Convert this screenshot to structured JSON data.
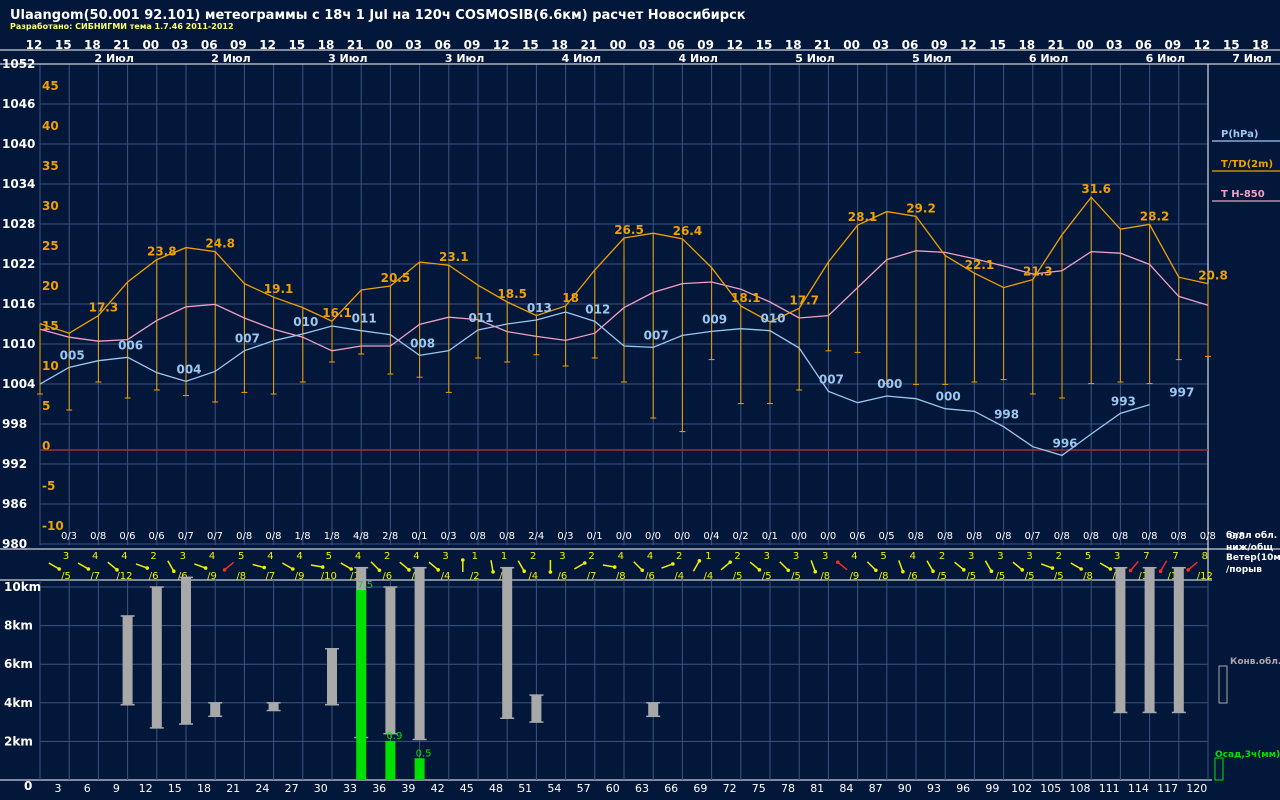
{
  "title": "Ulaangom(50.001 92.101) метеограммы с  18ч 1 Jul на 120ч COSMOSIB(6.6км) расчет Новосибирск",
  "subtitle": "Разработано: СИБНИГМИ тема 1.7.46 2011-2012",
  "colors": {
    "background": "#03173a",
    "grid": "#3a5580",
    "pressure": "#9cc8f0",
    "temperature": "#f0a000",
    "t850": "#f0a0c0",
    "zero": "#a03030",
    "cloud": "#a8a8a8",
    "precip": "#00e000",
    "wind": "#f0f000",
    "wind_strong": "#f03020",
    "text": "#ffffff"
  },
  "chart_data": [
    {
      "type": "line",
      "name": "meteogram",
      "hours_top": [
        "12",
        "15",
        "18",
        "21",
        "00",
        "03",
        "06",
        "09",
        "12",
        "15",
        "18",
        "21",
        "00",
        "03",
        "06",
        "09",
        "12",
        "15",
        "18",
        "21",
        "00",
        "03",
        "06",
        "09",
        "12",
        "15",
        "18",
        "21",
        "00",
        "03",
        "06",
        "09",
        "12",
        "15",
        "18",
        "21",
        "00",
        "03",
        "06",
        "09",
        "12",
        "15",
        "18",
        "21",
        "00",
        "03",
        "06",
        "09",
        "12",
        "15",
        "18",
        "21",
        "00",
        "03",
        "06",
        "09",
        "12"
      ],
      "day_labels": [
        {
          "col": 1,
          "text": "2 Июл"
        },
        {
          "col": 5,
          "text": "2 Июл"
        },
        {
          "col": 9,
          "text": "3 Июл"
        },
        {
          "col": 13,
          "text": "3 Июл"
        },
        {
          "col": 17,
          "text": "4 Июл"
        },
        {
          "col": 21,
          "text": "4 Июл"
        },
        {
          "col": 25,
          "text": "5 Июл"
        },
        {
          "col": 29,
          "text": "5 Июл"
        },
        {
          "col": 33,
          "text": "6 Июл"
        },
        {
          "col": 37,
          "text": "6 Июл"
        }
      ],
      "day_label_right": "7 Июл",
      "pressure_ticks": [
        "1052",
        "1046",
        "1040",
        "1034",
        "1028",
        "1022",
        "1016",
        "1010",
        "1004",
        "998",
        "992",
        "986",
        "980"
      ],
      "temp_ticks": [
        "45",
        "40",
        "35",
        "30",
        "25",
        "20",
        "15",
        "10",
        "5",
        "0",
        "-5",
        "-10"
      ],
      "legend": {
        "pressure": "P(hPa)",
        "temperature": "T/TD(2m)",
        "t850": "T H-850"
      },
      "pressure": [
        1004,
        1006.5,
        1007.5,
        1008,
        1005.7,
        1004.4,
        1005.9,
        1009,
        1010.5,
        1011.5,
        1012.7,
        1012,
        1011.4,
        1008.3,
        1009,
        1012.1,
        1013,
        1013.6,
        1014.8,
        1013.4,
        1009.7,
        1009.5,
        1011.3,
        1011.9,
        1012.3,
        1012,
        1009.4,
        1002.9,
        1001.2,
        1002.2,
        1001.8,
        1000.3,
        999.9,
        997.6,
        994.6,
        993.3,
        996.5,
        999.6,
        1000.9
      ],
      "pressure_labels": [
        [
          1,
          "005"
        ],
        [
          3,
          "006"
        ],
        [
          5,
          "004"
        ],
        [
          7,
          "007"
        ],
        [
          9,
          "010"
        ],
        [
          11,
          "011"
        ],
        [
          13,
          "008"
        ],
        [
          15,
          "011"
        ],
        [
          17,
          "013"
        ],
        [
          19,
          "012"
        ],
        [
          21,
          "007"
        ],
        [
          23,
          "009"
        ],
        [
          25,
          "010"
        ],
        [
          27,
          "007"
        ],
        [
          29,
          "000"
        ],
        [
          31,
          "000"
        ],
        [
          33,
          "998"
        ],
        [
          35,
          "996"
        ],
        [
          37,
          "993"
        ],
        [
          39,
          "997"
        ]
      ],
      "temp_max": [
        15.8,
        14.6,
        16.8,
        21,
        23.8,
        25.3,
        24.8,
        20.8,
        19.1,
        17.8,
        16.1,
        20,
        20.5,
        23.5,
        23.1,
        20.6,
        18.5,
        16.8,
        18,
        22.5,
        26.5,
        27.1,
        26.4,
        22.8,
        18,
        16,
        17.7,
        23.5,
        28.1,
        29.8,
        29.2,
        24.3,
        22.1,
        20.3,
        21.3,
        26.9,
        31.6,
        27.6,
        28.2,
        21.6,
        20.8
      ],
      "temp_min": [
        7,
        5,
        8.5,
        6.5,
        7.5,
        6.8,
        6,
        7.2,
        7,
        8.5,
        11,
        12,
        9.5,
        9.1,
        7.2,
        11.5,
        11,
        11.9,
        10.5,
        11.5,
        8.5,
        4,
        2.3,
        11.3,
        5.8,
        5.8,
        7.5,
        12.4,
        12.2,
        8.3,
        8.2,
        8.2,
        8.5,
        8.8,
        7,
        6.5,
        8.3,
        8.5,
        8.3,
        11.3,
        11.7
      ],
      "temp_labels": [
        [
          2,
          "17.3"
        ],
        [
          4,
          "23.8"
        ],
        [
          6,
          "24.8"
        ],
        [
          8,
          "19.1"
        ],
        [
          10,
          "16.1"
        ],
        [
          12,
          "20.5"
        ],
        [
          14,
          "23.1"
        ],
        [
          16,
          "18.5"
        ],
        [
          18,
          "18"
        ],
        [
          20,
          "26.5"
        ],
        [
          22,
          "26.4"
        ],
        [
          24,
          "18.1"
        ],
        [
          26,
          "17.7"
        ],
        [
          28,
          "28.1"
        ],
        [
          30,
          "29.2"
        ],
        [
          32,
          "22.1"
        ],
        [
          34,
          "21.3"
        ],
        [
          36,
          "31.6"
        ],
        [
          38,
          "28.2"
        ],
        [
          40,
          "20.8"
        ]
      ],
      "t850": [
        15.1,
        14.1,
        13.6,
        13.8,
        16.2,
        17.9,
        18.2,
        16.5,
        15.1,
        14.1,
        12.4,
        13,
        13,
        15.7,
        16.6,
        16.3,
        14.8,
        14.2,
        13.7,
        14.6,
        17.8,
        19.7,
        20.8,
        21,
        20.1,
        18.5,
        16.5,
        16.8,
        20.3,
        23.8,
        24.9,
        24.7,
        23.9,
        23,
        22,
        22.4,
        24.8,
        24.6,
        23.2,
        19.2,
        18.1
      ],
      "cloud_cover": [
        "0/3",
        "0/8",
        "0/6",
        "0/6",
        "0/7",
        "0/7",
        "0/8",
        "0/8",
        "1/8",
        "1/8",
        "4/8",
        "2/8",
        "0/1",
        "0/3",
        "0/8",
        "0/8",
        "2/4",
        "0/3",
        "0/1",
        "0/0",
        "0/0",
        "0/0",
        "0/4",
        "0/2",
        "0/1",
        "0/0",
        "0/0",
        "0/6",
        "0/5",
        "0/8",
        "0/8",
        "0/8",
        "0/8",
        "0/7",
        "0/8",
        "0/8",
        "0/8",
        "0/8",
        "0/8",
        "0/8",
        "0/8"
      ],
      "cloud_label": [
        "балл обл.",
        "ниж/общ"
      ],
      "wind_speed": [
        "3",
        "4",
        "4",
        "2",
        "3",
        "4",
        "5",
        "4",
        "4",
        "5",
        "4",
        "2",
        "4",
        "3",
        "1",
        "1",
        "2",
        "3",
        "2",
        "4",
        "4",
        "2",
        "1",
        "2",
        "3",
        "3",
        "3",
        "4",
        "5",
        "4",
        "2",
        "3",
        "3",
        "3",
        "2",
        "5",
        "3",
        "7",
        "7",
        "8"
      ],
      "wind_gust": [
        "/5",
        "/7",
        "/12",
        "/6",
        "/6",
        "/9",
        "/8",
        "/7",
        "/9",
        "/10",
        "/10",
        "/6",
        "/6",
        "/4",
        "/2",
        "/3",
        "/4",
        "/6",
        "/7",
        "/8",
        "/6",
        "/4",
        "/4",
        "/5",
        "/5",
        "/5",
        "/8",
        "/9",
        "/8",
        "/6",
        "/5",
        "/5",
        "/5",
        "/5",
        "/5",
        "/8",
        "/8",
        "/11",
        "/16",
        "/12"
      ],
      "wind_dir": [
        30,
        30,
        40,
        20,
        60,
        20,
        140,
        15,
        30,
        10,
        30,
        45,
        40,
        40,
        -90,
        80,
        60,
        90,
        -30,
        10,
        45,
        -20,
        -60,
        -40,
        40,
        45,
        70,
        -140,
        45,
        70,
        60,
        40,
        60,
        40,
        20,
        30,
        30,
        130,
        120,
        140
      ],
      "wind_label": [
        "Ветер(10м)",
        "/порыв"
      ],
      "height_ticks": [
        "10km",
        "8km",
        "6km",
        "4km",
        "2km",
        "0"
      ],
      "forecast_hours": [
        "3",
        "6",
        "9",
        "12",
        "15",
        "18",
        "21",
        "24",
        "27",
        "30",
        "33",
        "36",
        "39",
        "42",
        "45",
        "48",
        "51",
        "54",
        "57",
        "60",
        "63",
        "66",
        "69",
        "72",
        "75",
        "78",
        "81",
        "84",
        "87",
        "90",
        "93",
        "96",
        "99",
        "102",
        "105",
        "108",
        "111",
        "114",
        "117",
        "120"
      ],
      "convective_clouds": [
        [
          3,
          3.9,
          8.5
        ],
        [
          4,
          2.7,
          10
        ],
        [
          5,
          2.9,
          10.5
        ],
        [
          6,
          3.3,
          4
        ],
        [
          8,
          3.6,
          4
        ],
        [
          10,
          3.9,
          6.8
        ],
        [
          11,
          2.2,
          11
        ],
        [
          12,
          2.4,
          10
        ],
        [
          13,
          2.1,
          11
        ],
        [
          16,
          3.2,
          11
        ],
        [
          17,
          3,
          4.4
        ],
        [
          21,
          3.3,
          4
        ],
        [
          37,
          3.5,
          11
        ],
        [
          38,
          3.5,
          11
        ],
        [
          39,
          3.5,
          11
        ]
      ],
      "precip": [
        [
          11,
          7.5
        ],
        [
          12,
          0.9
        ],
        [
          13,
          0.5
        ]
      ],
      "precip_labels": [
        [
          11,
          "7.5"
        ],
        [
          12,
          "0.9"
        ],
        [
          13,
          "0.5"
        ]
      ],
      "bottom_legend": {
        "cloud": "Конв.обл.",
        "precip": "Осад,3ч(мм)"
      }
    }
  ]
}
